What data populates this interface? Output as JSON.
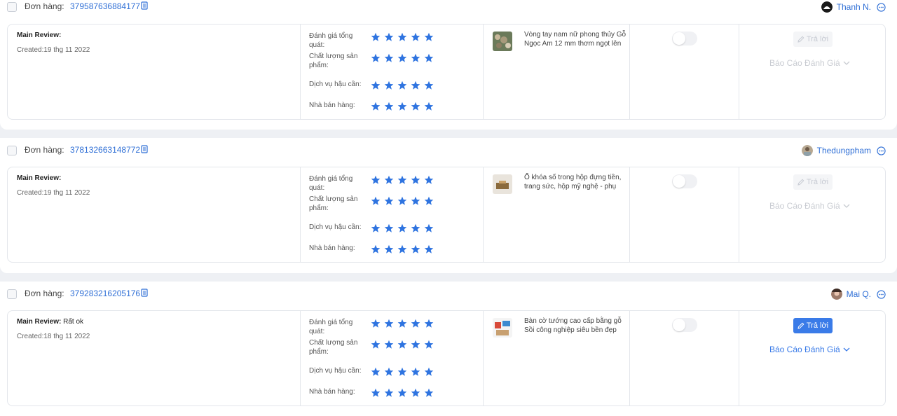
{
  "labels": {
    "order": "Đơn hàng:",
    "main_review": "Main Review:",
    "created_prefix": "Created:",
    "rating_overall": "Đánh giá tổng quát:",
    "rating_quality": "Chất lượng sản phẩm:",
    "rating_logistics": "Dịch vụ hậu cần:",
    "rating_seller": "Nhà bán hàng:",
    "reply": "Trả lời",
    "report": "Báo Cáo Đánh Giá"
  },
  "colors": {
    "accent": "#3a7be8",
    "star": "#2f74e0"
  },
  "reviews": [
    {
      "order_id": "379587636884177",
      "username": "Thanh N.",
      "main_review_text": "",
      "created": "19 thg 11 2022",
      "ratings": {
        "overall": 5,
        "quality": 5,
        "logistics": 5,
        "seller": 5
      },
      "product_name": "Vòng tay nam nữ phong thủy Gỗ Ngọc Am 12 mm thơm ngọt lên tuyết",
      "reply_enabled": false,
      "report_enabled": false,
      "avatar_icon": "dark-user-avatar"
    },
    {
      "order_id": "378132663148772",
      "username": "Thedungpham",
      "main_review_text": "",
      "created": "19 thg 11 2022",
      "ratings": {
        "overall": 5,
        "quality": 5,
        "logistics": 5,
        "seller": 5
      },
      "product_name": "Ổ khóa số trong hộp đựng tiền, trang sức, hộp mỹ nghệ - phụ kiện trang",
      "reply_enabled": false,
      "report_enabled": false,
      "avatar_icon": "photo-user-avatar"
    },
    {
      "order_id": "379283216205176",
      "username": "Mai Q.",
      "main_review_text": "Rất ok",
      "created": "18 thg 11 2022",
      "ratings": {
        "overall": 5,
        "quality": 5,
        "logistics": 5,
        "seller": 5
      },
      "product_name": "Bàn cờ tướng cao cấp bằng gỗ Sồi công nghiệp siêu bền đẹp bảo hành",
      "reply_enabled": true,
      "report_enabled": true,
      "avatar_icon": "photo-user-avatar"
    }
  ]
}
